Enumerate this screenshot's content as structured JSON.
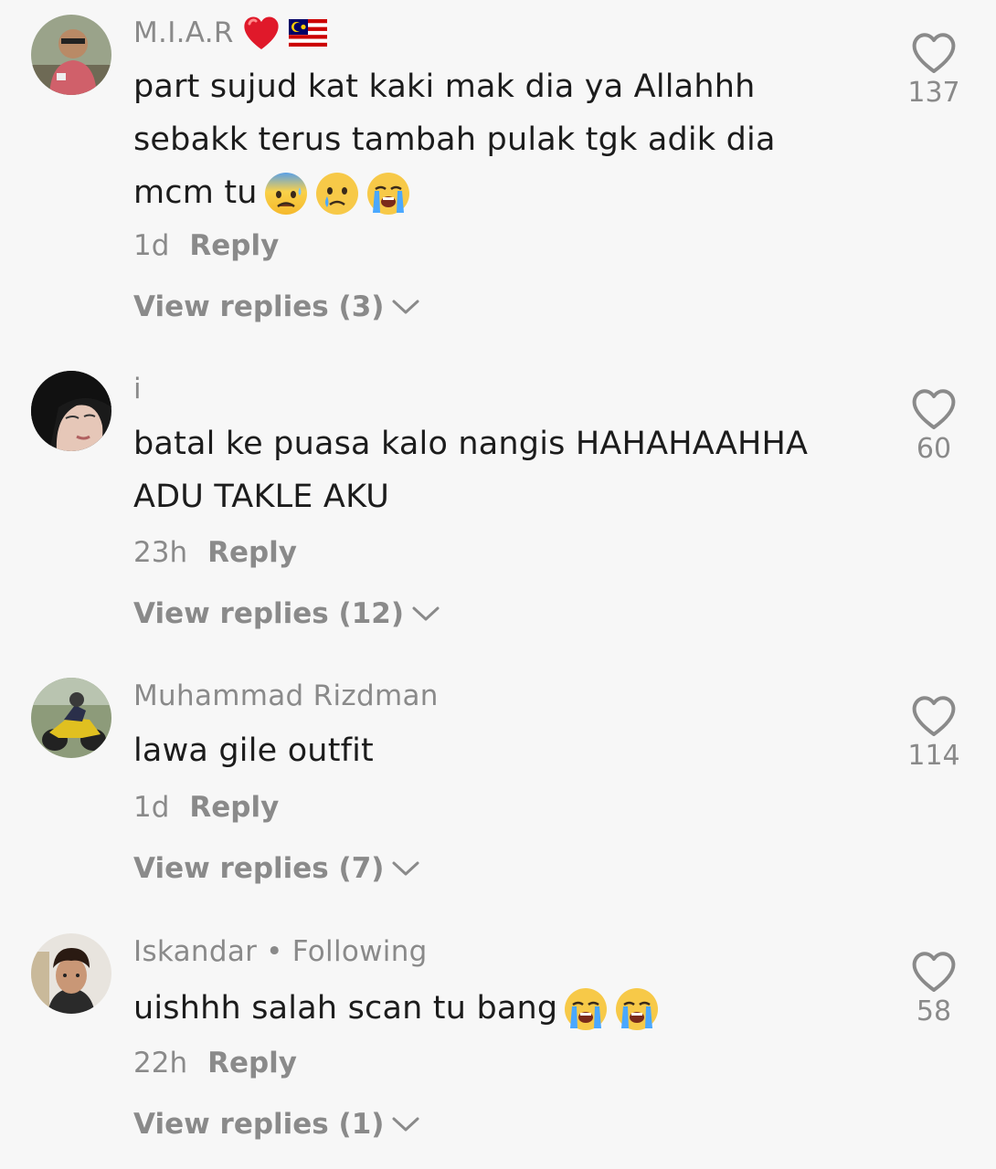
{
  "comments": [
    {
      "username": "M.I.A.R",
      "username_emojis": [
        "red-heart",
        "malaysia-flag"
      ],
      "lines": [
        "part sujud kat kaki mak dia ya Allahhh",
        "sebakk terus tambah pulak tgk adik dia",
        "mcm tu"
      ],
      "text_emojis": [
        "anxious-face",
        "sad-tear-face",
        "crying-face"
      ],
      "time": "1d",
      "reply_label": "Reply",
      "view_replies": "View replies (3)",
      "likes": "137"
    },
    {
      "username": "i",
      "lines": [
        "batal ke puasa kalo nangis HAHAHAAHHA",
        "ADU TAKLE AKU"
      ],
      "time": "23h",
      "reply_label": "Reply",
      "view_replies": "View replies (12)",
      "likes": "60"
    },
    {
      "username": "Muhammad Rizdman",
      "lines": [
        "lawa gile outfit"
      ],
      "time": "1d",
      "reply_label": "Reply",
      "view_replies": "View replies (7)",
      "likes": "114"
    },
    {
      "username": "Iskandar",
      "following_label": "Following",
      "lines": [
        "uishhh salah scan tu bang"
      ],
      "text_emojis": [
        "crying-face",
        "crying-face"
      ],
      "time": "22h",
      "reply_label": "Reply",
      "view_replies": "View replies (1)",
      "likes": "58"
    }
  ],
  "colors": {
    "background": "#f7f7f7",
    "text": "#1c1c1c",
    "secondary": "#8a8a8a"
  }
}
